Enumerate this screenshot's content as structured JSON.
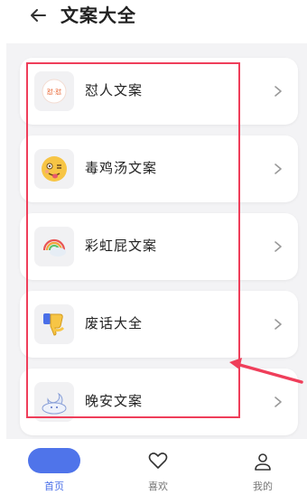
{
  "header": {
    "title": "文案大全"
  },
  "cards": [
    {
      "label": "怼人文案",
      "icon": "badge-icon",
      "icon_text": "怼·怼"
    },
    {
      "label": "毒鸡汤文案",
      "icon": "dizzy-face-icon"
    },
    {
      "label": "彩虹屁文案",
      "icon": "rainbow-cloud-icon"
    },
    {
      "label": "废话大全",
      "icon": "thumbs-down-icon"
    },
    {
      "label": "晚安文案",
      "icon": "moon-cloud-icon"
    }
  ],
  "nav": {
    "home": "首页",
    "like": "喜欢",
    "mine": "我的"
  },
  "colors": {
    "accent": "#4f74ea",
    "annotation": "#ef3e5a",
    "background": "#f3f3f5"
  }
}
